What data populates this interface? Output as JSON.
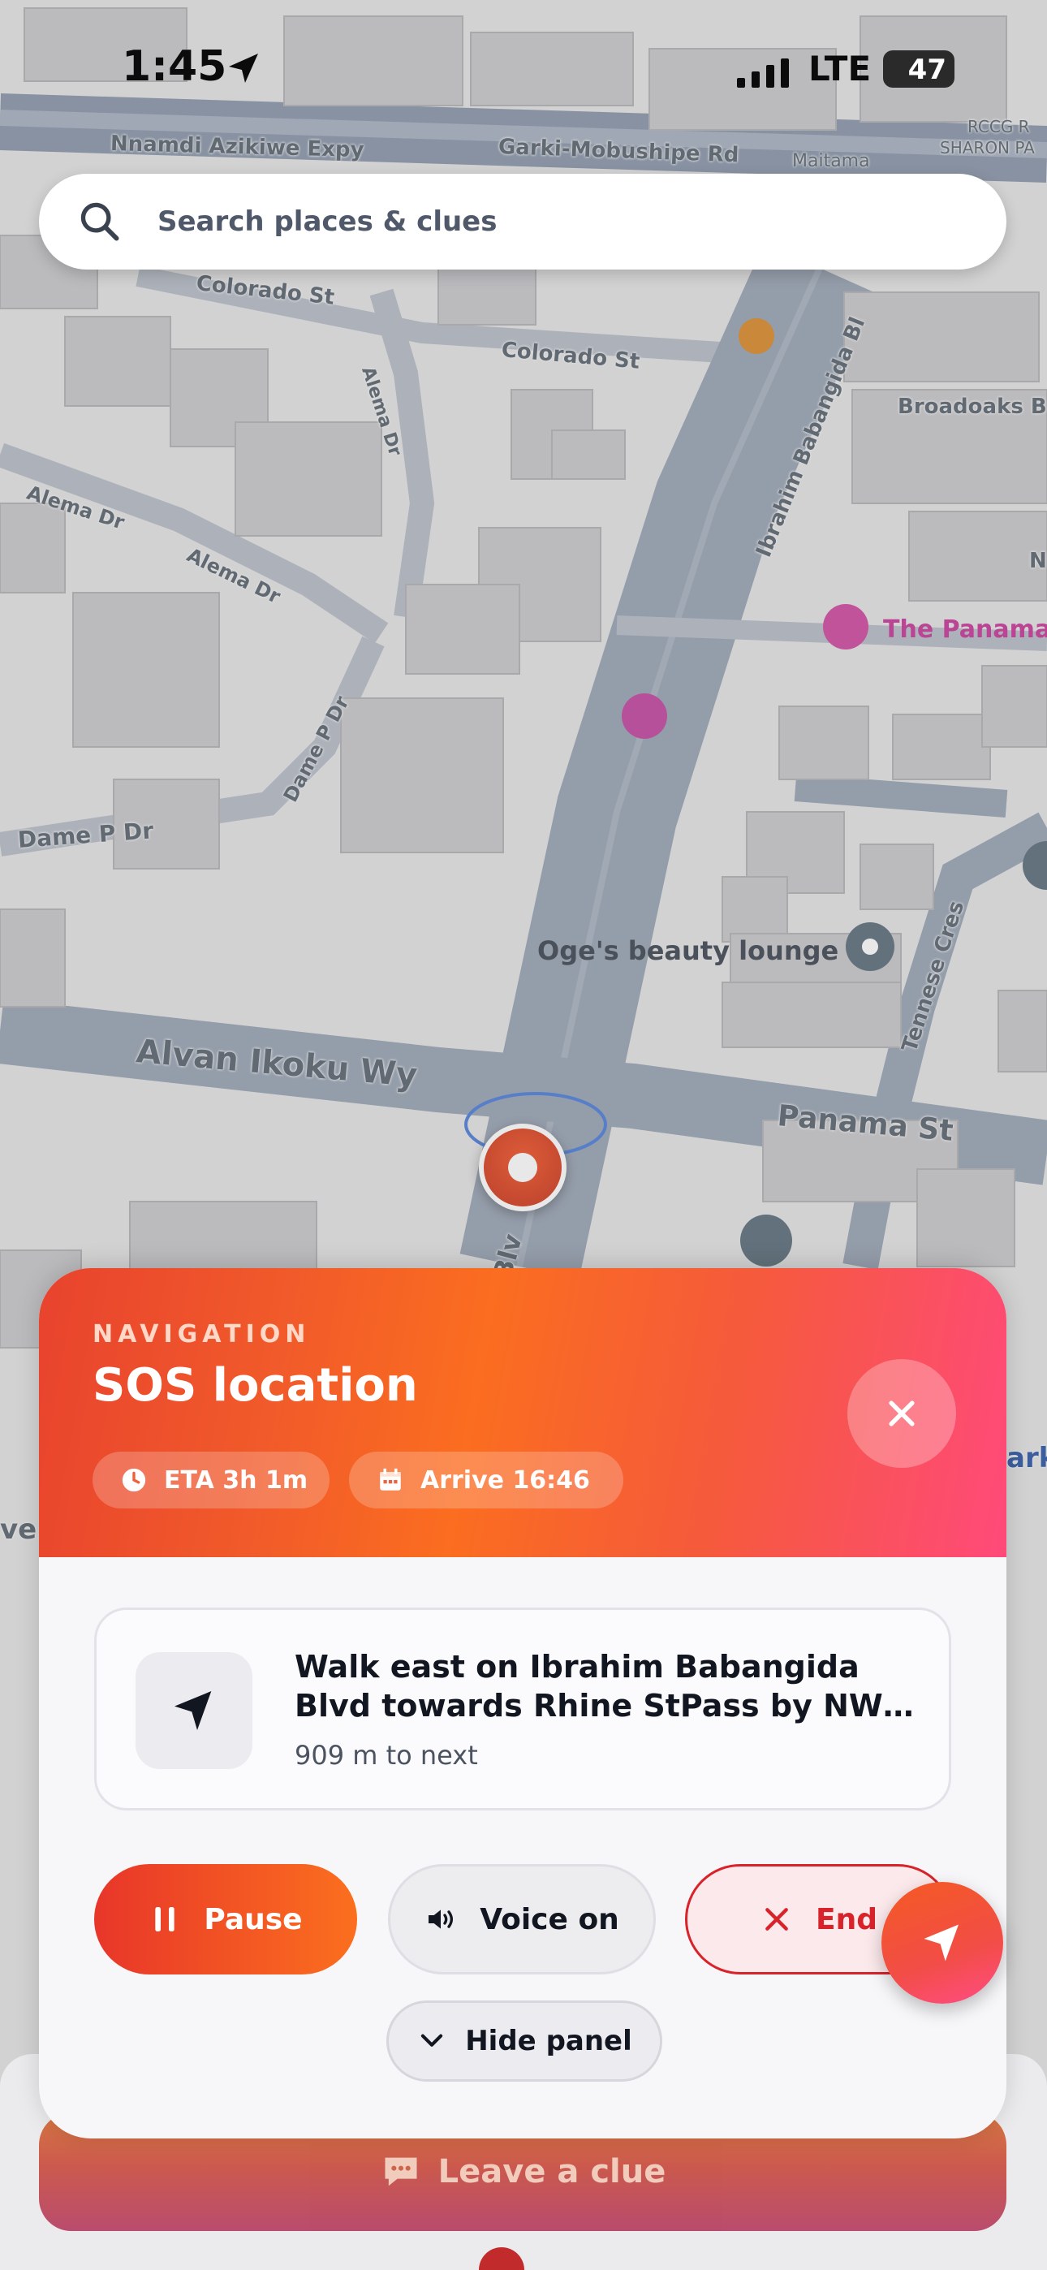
{
  "status_bar": {
    "time": "1:45",
    "network": "LTE",
    "battery": "47"
  },
  "search": {
    "placeholder": "Search places & clues"
  },
  "map": {
    "roads": [
      "Nnamdi Azikiwe Expy",
      "Garki-Mobushipe Rd",
      "Maitama",
      "RCCG R",
      "SHARON PA",
      "Colorado St",
      "Colorado St",
      "Ibrahim Babangida Bl",
      "Alema Dr",
      "Alema Dr",
      "Alema Dr",
      "Broadoaks Bri",
      "N",
      "Dame P Dr",
      "Dame P Dr",
      "Alvan Ikoku Wy",
      "Panama St",
      "Tennese Cres",
      "Blv",
      "ark",
      "ve"
    ],
    "pois": {
      "hotel": "The Panama",
      "beauty": "Oge's beauty lounge"
    }
  },
  "navigation": {
    "kicker": "NAVIGATION",
    "title": "SOS location",
    "eta": "ETA 3h 1m",
    "arrive": "Arrive 16:46",
    "instruction_line1": "Walk east on Ibrahim Babangida",
    "instruction_line2": "Blvd towards Rhine StPass by NW…",
    "distance": "909 m to next",
    "pause_label": "Pause",
    "voice_label": "Voice on",
    "end_label": "End",
    "hide_label": "Hide panel"
  },
  "leave_clue": {
    "label": "Leave a clue"
  },
  "colors": {
    "accent_orange": "#fb6d20",
    "accent_red": "#e8432e",
    "accent_pink": "#ff4a7a",
    "end_red": "#d8232a"
  }
}
